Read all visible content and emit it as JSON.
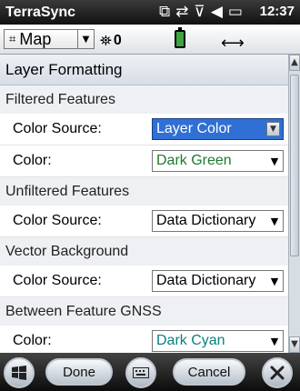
{
  "titlebar": {
    "app_name": "TerraSync",
    "clock": "12:37"
  },
  "toolbar": {
    "map_label": "Map",
    "satellite_count": "0"
  },
  "page": {
    "header": "Layer Formatting",
    "sections": [
      {
        "title": "Filtered Features",
        "rows": [
          {
            "label": "Color Source:",
            "value": "Layer Color",
            "value_color": "#ffffff",
            "active": true
          },
          {
            "label": "Color:",
            "value": "Dark Green",
            "value_color": "#1e7a2e",
            "active": false
          }
        ]
      },
      {
        "title": "Unfiltered Features",
        "rows": [
          {
            "label": "Color Source:",
            "value": "Data Dictionary",
            "value_color": "#000000",
            "active": false
          }
        ]
      },
      {
        "title": "Vector Background",
        "rows": [
          {
            "label": "Color Source:",
            "value": "Data Dictionary",
            "value_color": "#000000",
            "active": false
          }
        ]
      },
      {
        "title": "Between Feature GNSS",
        "rows": [
          {
            "label": "Color:",
            "value": "Dark Cyan",
            "value_color": "#0b7f7f",
            "active": false
          }
        ]
      }
    ]
  },
  "bottombar": {
    "done_label": "Done",
    "cancel_label": "Cancel"
  },
  "colors": {
    "active_select": "#2f6fd6"
  },
  "icons": [
    "windows-start-icon",
    "keyboard-icon",
    "close-icon",
    "signal-icon",
    "sync-icon",
    "volume-icon",
    "battery-status-icon",
    "satellite-icon",
    "battery-icon",
    "map-grid-icon",
    "double-arrow-icon"
  ]
}
